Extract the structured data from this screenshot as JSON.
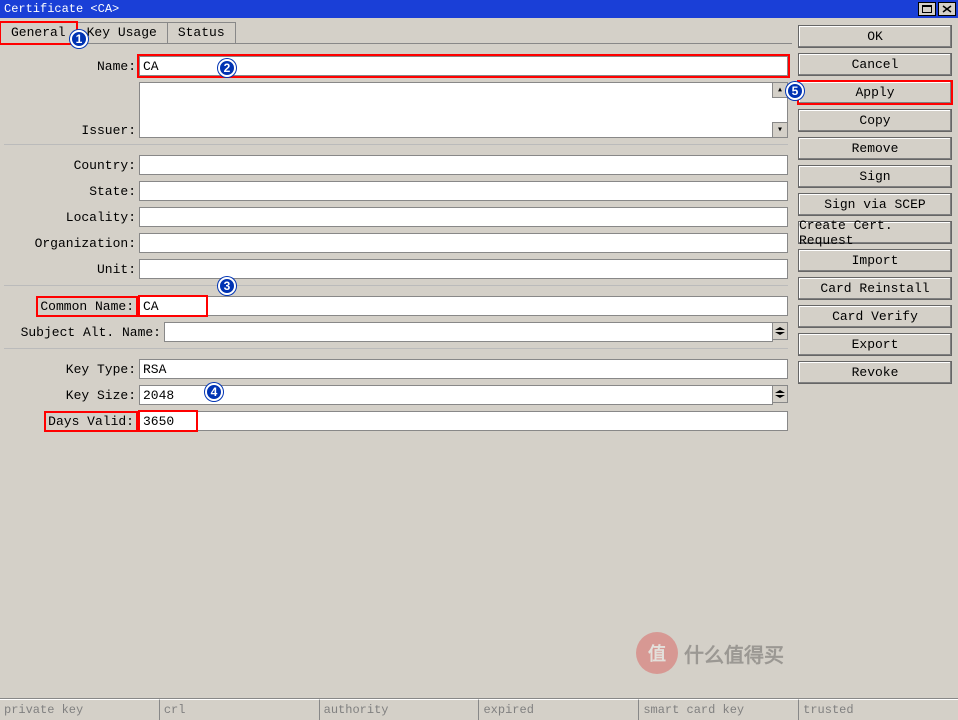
{
  "window": {
    "title": "Certificate <CA>"
  },
  "tabs": {
    "general": "General",
    "key_usage": "Key Usage",
    "status": "Status"
  },
  "labels": {
    "name": "Name:",
    "issuer": "Issuer:",
    "country": "Country:",
    "state": "State:",
    "locality": "Locality:",
    "organization": "Organization:",
    "unit": "Unit:",
    "common_name": "Common Name:",
    "san": "Subject Alt. Name:",
    "key_type": "Key Type:",
    "key_size": "Key Size:",
    "days_valid": "Days Valid:"
  },
  "values": {
    "name": "CA",
    "issuer": "",
    "country": "",
    "state": "",
    "locality": "",
    "organization": "",
    "unit": "",
    "common_name": "CA",
    "san": "",
    "key_type": "RSA",
    "key_size": "2048",
    "days_valid": "3650"
  },
  "buttons": {
    "ok": "OK",
    "cancel": "Cancel",
    "apply": "Apply",
    "copy": "Copy",
    "remove": "Remove",
    "sign": "Sign",
    "sign_scep": "Sign via SCEP",
    "create_req": "Create Cert. Request",
    "import": "Import",
    "card_reinstall": "Card Reinstall",
    "card_verify": "Card Verify",
    "export": "Export",
    "revoke": "Revoke"
  },
  "status_cells": {
    "c1": "private key",
    "c2": "crl",
    "c3": "authority",
    "c4": "expired",
    "c5": "smart card key",
    "c6": "trusted"
  },
  "annotations": {
    "b1": "1",
    "b2": "2",
    "b3": "3",
    "b4": "4",
    "b5": "5"
  },
  "watermark": {
    "icon": "值",
    "text": "什么值得买"
  }
}
